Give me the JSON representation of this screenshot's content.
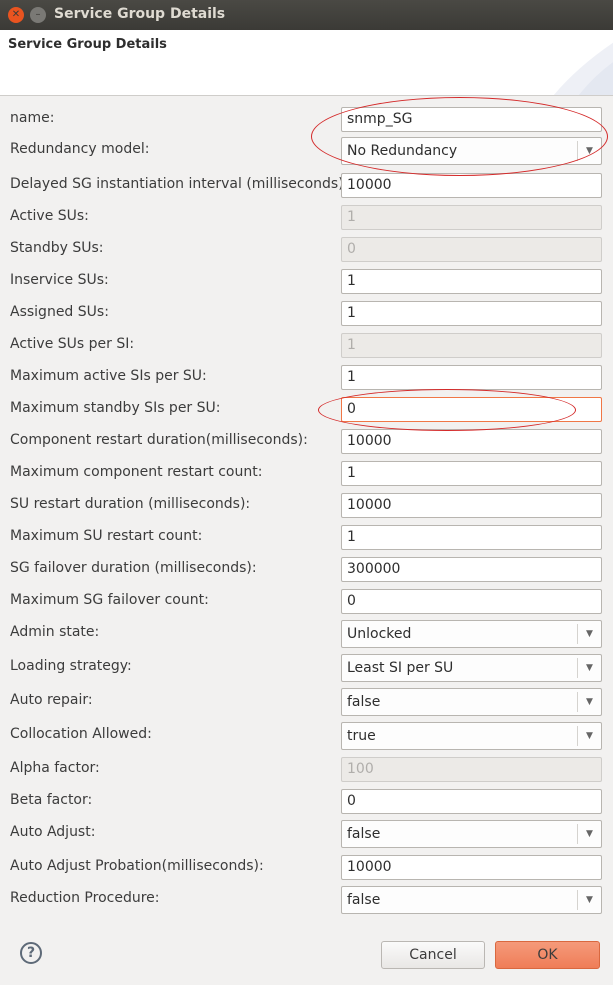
{
  "window": {
    "title": "Service Group Details"
  },
  "banner": {
    "title": "Service Group Details"
  },
  "fields": [
    {
      "label": "name:",
      "value": "snmp_SG",
      "kind": "text"
    },
    {
      "label": "Redundancy model:",
      "value": "No Redundancy",
      "kind": "select"
    },
    {
      "label": "Delayed SG instantiation interval (milliseconds):",
      "value": "10000",
      "kind": "text"
    },
    {
      "label": "Active SUs:",
      "value": "1",
      "kind": "disabled"
    },
    {
      "label": "Standby SUs:",
      "value": "0",
      "kind": "disabled"
    },
    {
      "label": "Inservice SUs:",
      "value": "1",
      "kind": "text"
    },
    {
      "label": "Assigned SUs:",
      "value": "1",
      "kind": "text"
    },
    {
      "label": "Active SUs per SI:",
      "value": "1",
      "kind": "disabled"
    },
    {
      "label": "Maximum active SIs per SU:",
      "value": "1",
      "kind": "text"
    },
    {
      "label": "Maximum standby SIs per SU:",
      "value": "0",
      "kind": "focused"
    },
    {
      "label": "Component restart duration(milliseconds):",
      "value": "10000",
      "kind": "text"
    },
    {
      "label": "Maximum component restart count:",
      "value": "1",
      "kind": "text"
    },
    {
      "label": "SU restart duration (milliseconds):",
      "value": "10000",
      "kind": "text"
    },
    {
      "label": "Maximum SU restart count:",
      "value": "1",
      "kind": "text"
    },
    {
      "label": "SG failover duration (milliseconds):",
      "value": "300000",
      "kind": "text"
    },
    {
      "label": "Maximum SG failover count:",
      "value": "0",
      "kind": "text"
    },
    {
      "label": "Admin state:",
      "value": "Unlocked",
      "kind": "select"
    },
    {
      "label": "Loading strategy:",
      "value": "Least SI per SU",
      "kind": "select"
    },
    {
      "label": "Auto repair:",
      "value": "false",
      "kind": "select"
    },
    {
      "label": "Collocation Allowed:",
      "value": "true",
      "kind": "select"
    },
    {
      "label": "Alpha factor:",
      "value": "100",
      "kind": "disabled"
    },
    {
      "label": "Beta factor:",
      "value": "0",
      "kind": "text"
    },
    {
      "label": "Auto Adjust:",
      "value": "false",
      "kind": "select"
    },
    {
      "label": "Auto Adjust Probation(milliseconds):",
      "value": "10000",
      "kind": "text"
    },
    {
      "label": "Reduction Procedure:",
      "value": "false",
      "kind": "select"
    }
  ],
  "buttons": {
    "help": "?",
    "cancel": "Cancel",
    "ok": "OK"
  },
  "colors": {
    "accent": "#ef7d58",
    "annotation": "#d42a2a",
    "titlebar": "#3b3a36"
  },
  "icons": {
    "close": "close-icon",
    "minimize": "minimize-icon",
    "dropdown": "chevron-down-icon",
    "help": "help-icon"
  }
}
